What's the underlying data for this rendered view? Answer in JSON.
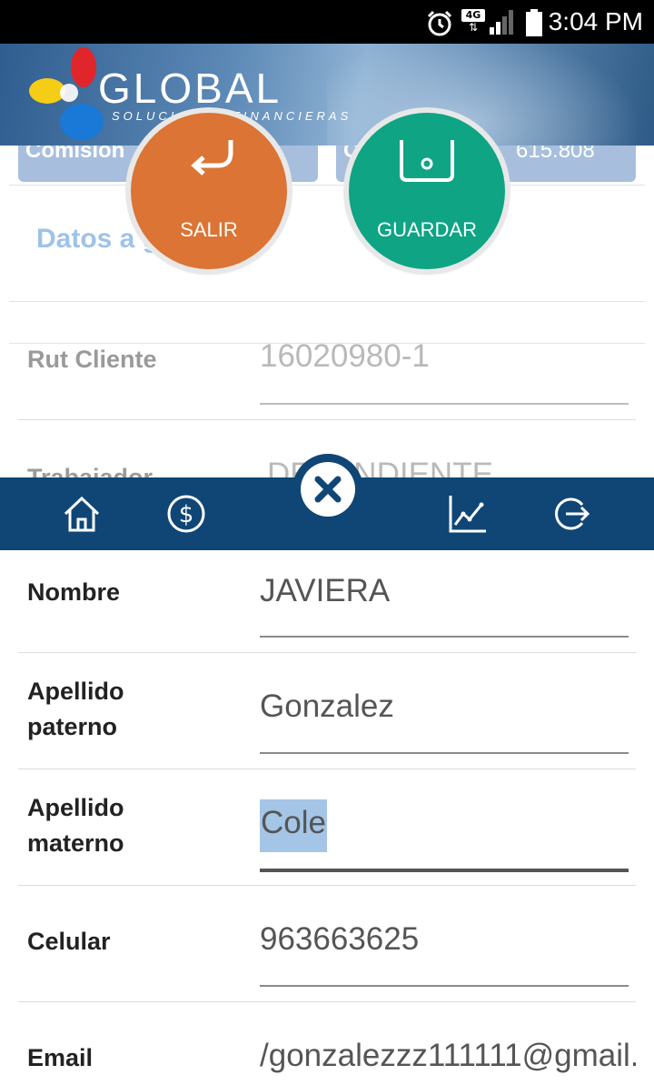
{
  "status_bar": {
    "time": "3:04 PM",
    "network": "4G",
    "icons": [
      "alarm-icon",
      "network-4g-icon",
      "signal-icon",
      "battery-icon"
    ]
  },
  "header": {
    "brand": "GLOBAL",
    "tagline": "SOLUCIONES FINANCIERAS"
  },
  "summary_cards": [
    {
      "label": "Comisión"
    },
    {
      "label": "C",
      "value": "615.808"
    }
  ],
  "actions": {
    "exit_label": "SALIR",
    "save_label": "GUARDAR"
  },
  "section": {
    "title": "Datos a g"
  },
  "form": {
    "rut": {
      "label": "Rut Cliente",
      "value": "16020980-1"
    },
    "trabajador": {
      "label": "Trabajador",
      "value": "DEPENDIENTE"
    },
    "nombre": {
      "label": "Nombre",
      "value": "JAVIERA"
    },
    "apellido_paterno": {
      "label_line1": "Apellido",
      "label_line2": "paterno",
      "value": "Gonzalez"
    },
    "apellido_materno": {
      "label_line1": "Apellido",
      "label_line2": "materno",
      "value": "Cole"
    },
    "celular": {
      "label": "Celular",
      "value": "963663625"
    },
    "email": {
      "label": "Email",
      "value": "/gonzalezzz111111@gmail."
    }
  },
  "nav": {
    "items": [
      "home-icon",
      "dollar-icon",
      "close-icon",
      "chart-icon",
      "logout-icon"
    ]
  },
  "colors": {
    "nav_bg": "#0f4675",
    "salir": "#db7434",
    "guardar": "#0ea484",
    "selection": "#a4c5e6"
  }
}
